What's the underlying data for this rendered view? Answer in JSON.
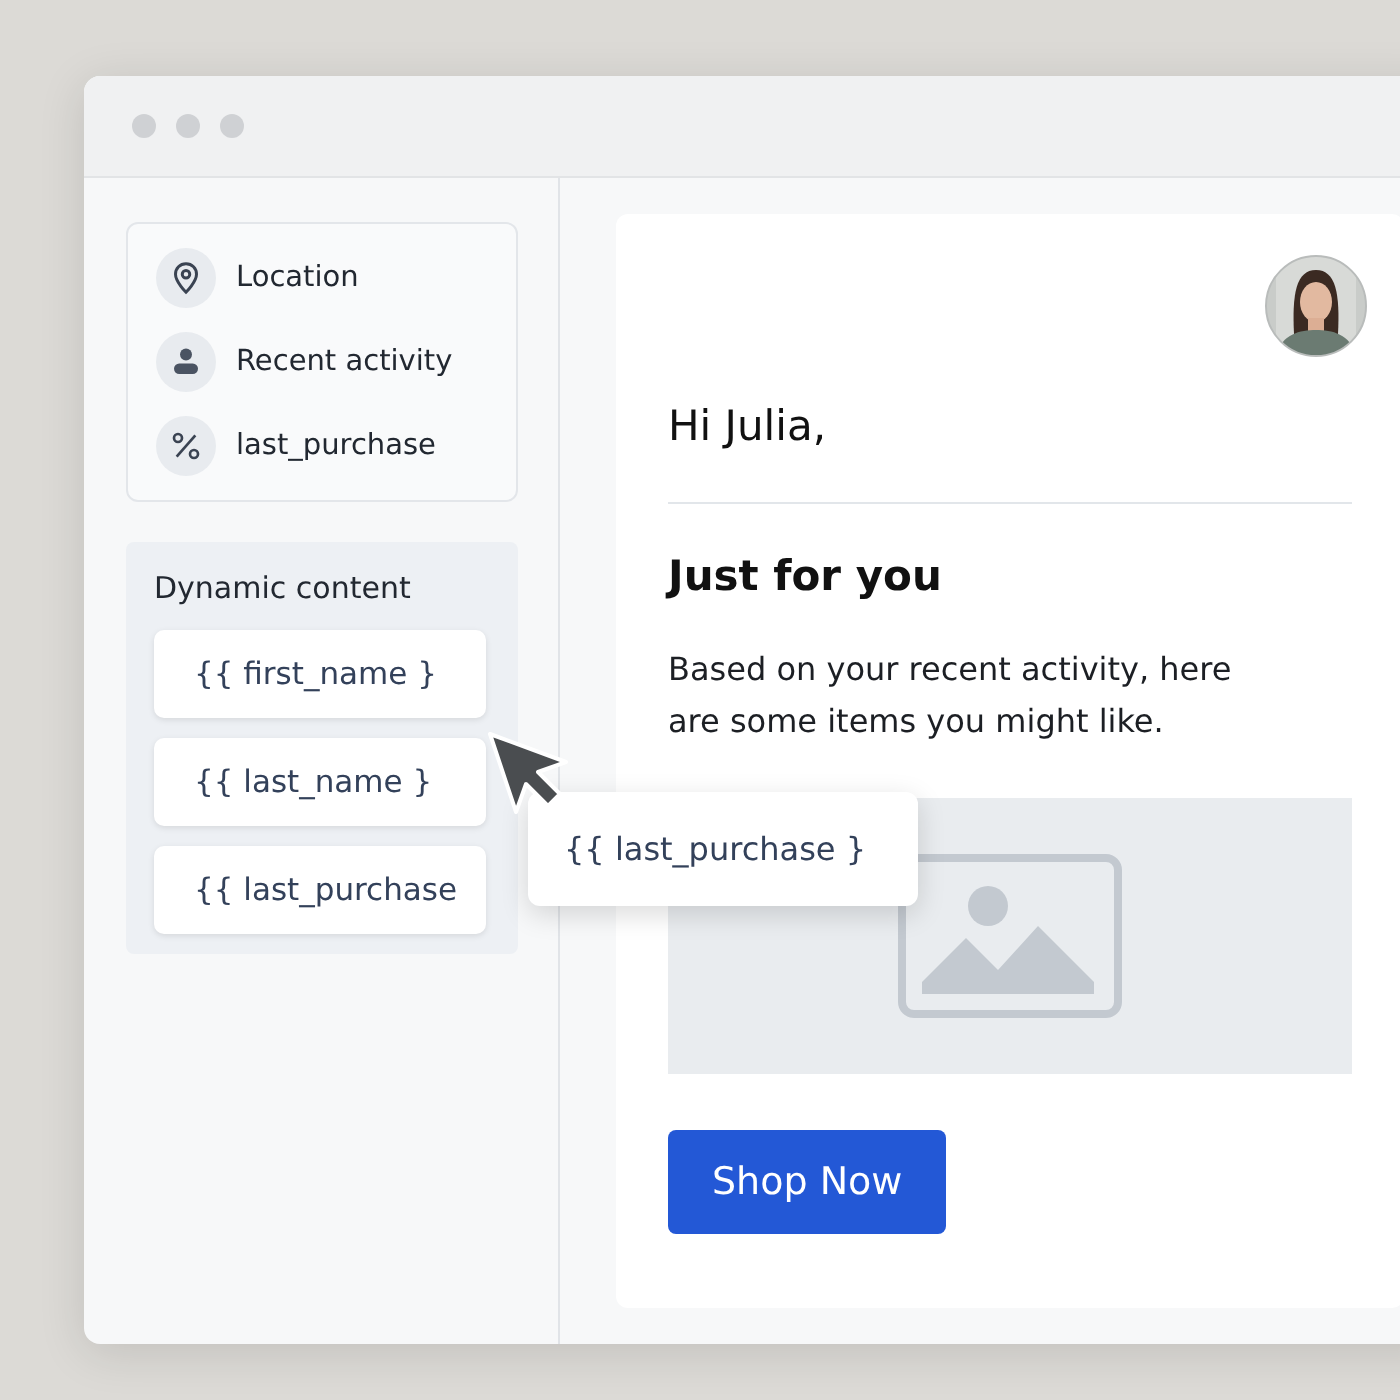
{
  "attributes": [
    {
      "kind": "location",
      "label": "Location"
    },
    {
      "kind": "person",
      "label": "Recent activity"
    },
    {
      "kind": "percent",
      "label": "last_purchase"
    }
  ],
  "dynamic_content": {
    "title": "Dynamic content",
    "tokens": [
      "{{ first_name }",
      "{{ last_name }",
      "{{ last_purchase"
    ]
  },
  "dragged_token": "{{ last_purchase }",
  "email": {
    "greeting": "Hi Julia,",
    "heading": "Just for you",
    "body": "Based on your recent activity, here are some items you might like.",
    "button": "Shop Now"
  }
}
